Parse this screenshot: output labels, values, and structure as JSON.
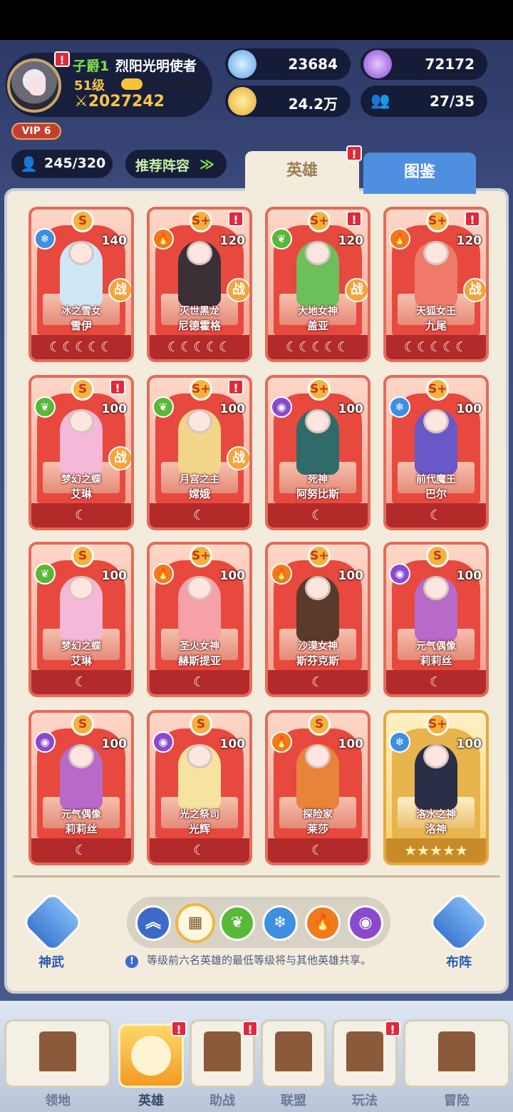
{
  "player": {
    "rank": "子爵1",
    "honor_title": "烈阳光明使者",
    "level": "51级",
    "xp_progress": 0.25,
    "power": "2027242",
    "vip": "VIP 6"
  },
  "resources": [
    {
      "icon": "star-crystal-icon",
      "value": "23684"
    },
    {
      "icon": "purple-gem-icon",
      "value": "72172"
    },
    {
      "icon": "gold-coin-icon",
      "value": "24.2万"
    },
    {
      "icon": "friends-icon",
      "value": "27/35"
    }
  ],
  "hero_count": "245/320",
  "recommend_label": "推荐阵容",
  "tabs": {
    "heroes": "英雄",
    "album": "图鉴"
  },
  "heroes": [
    {
      "grade": "S",
      "element": "ice",
      "level": "140",
      "title": "冰之雪女",
      "name": "雪伊",
      "fight": true,
      "moons": 5,
      "alert": false,
      "color": "#cfe6f6"
    },
    {
      "grade": "S+",
      "element": "fire",
      "level": "120",
      "title": "灭世黑龙",
      "name": "尼德霍格",
      "fight": true,
      "moons": 5,
      "alert": true,
      "color": "#3a3036"
    },
    {
      "grade": "S+",
      "element": "wind",
      "level": "120",
      "title": "大地女神",
      "name": "盖亚",
      "fight": true,
      "moons": 5,
      "alert": true,
      "color": "#6cbf5a"
    },
    {
      "grade": "S+",
      "element": "fire",
      "level": "120",
      "title": "天狐女王",
      "name": "九尾",
      "fight": true,
      "moons": 5,
      "alert": true,
      "color": "#f07a6a"
    },
    {
      "grade": "S",
      "element": "wind",
      "level": "100",
      "title": "梦幻之蝶",
      "name": "艾琳",
      "fight": true,
      "moons": 1,
      "alert": true,
      "color": "#f5b8d8"
    },
    {
      "grade": "S+",
      "element": "wind",
      "level": "100",
      "title": "月宫之主",
      "name": "嫦娥",
      "fight": true,
      "moons": 1,
      "alert": true,
      "color": "#f3d58a"
    },
    {
      "grade": "S+",
      "element": "dark",
      "level": "100",
      "title": "死神",
      "name": "阿努比斯",
      "fight": false,
      "moons": 1,
      "alert": false,
      "color": "#2f6b6a"
    },
    {
      "grade": "S+",
      "element": "ice",
      "level": "100",
      "title": "前代魔王",
      "name": "巴尔",
      "fight": false,
      "moons": 1,
      "alert": false,
      "color": "#6a58c8"
    },
    {
      "grade": "S",
      "element": "wind",
      "level": "100",
      "title": "梦幻之蝶",
      "name": "艾琳",
      "fight": false,
      "moons": 1,
      "alert": false,
      "color": "#f5b8d8"
    },
    {
      "grade": "S+",
      "element": "fire",
      "level": "100",
      "title": "圣火女神",
      "name": "赫斯提亚",
      "fight": false,
      "moons": 1,
      "alert": false,
      "color": "#f6a0a8"
    },
    {
      "grade": "S+",
      "element": "fire",
      "level": "100",
      "title": "沙漠女神",
      "name": "斯芬克斯",
      "fight": false,
      "moons": 1,
      "alert": false,
      "color": "#5a3a2a"
    },
    {
      "grade": "S",
      "element": "dark",
      "level": "100",
      "title": "元气偶像",
      "name": "莉莉丝",
      "fight": false,
      "moons": 1,
      "alert": false,
      "color": "#b86ac8"
    },
    {
      "grade": "S",
      "element": "dark",
      "level": "100",
      "title": "元气偶像",
      "name": "莉莉丝",
      "fight": false,
      "moons": 1,
      "alert": false,
      "color": "#b86ac8"
    },
    {
      "grade": "S",
      "element": "dark",
      "level": "100",
      "title": "光之祭司",
      "name": "光辉",
      "fight": false,
      "moons": 1,
      "alert": false,
      "color": "#f6e3a0"
    },
    {
      "grade": "S",
      "element": "fire",
      "level": "100",
      "title": "探险家",
      "name": "莱莎",
      "fight": false,
      "moons": 1,
      "alert": false,
      "color": "#e8833a"
    },
    {
      "grade": "S+",
      "element": "ice",
      "level": "100",
      "title": "洛水之神",
      "name": "洛神",
      "fight": false,
      "stars": 5,
      "alert": false,
      "gold": true,
      "color": "#2a2f48"
    }
  ],
  "fight_label": "战",
  "element_colors": {
    "ice": "#3d8fe0",
    "fire": "#f07a1c",
    "wind": "#58b838",
    "dark": "#8a4ad0"
  },
  "element_glyphs": {
    "ice": "❄",
    "fire": "🔥",
    "wind": "❦",
    "dark": "◉"
  },
  "filters": [
    {
      "icon": "collapse-up-icon",
      "glyph": "︽",
      "color": "#3d6ac8"
    },
    {
      "icon": "grid-all-icon",
      "glyph": "▦",
      "color": "#fff7e0",
      "selected": true
    },
    {
      "icon": "wind-element-icon",
      "glyph": "❦",
      "color": "#58b838"
    },
    {
      "icon": "ice-element-icon",
      "glyph": "❄",
      "color": "#3d8fe0"
    },
    {
      "icon": "fire-element-icon",
      "glyph": "🔥",
      "color": "#f07a1c"
    },
    {
      "icon": "dark-element-icon",
      "glyph": "◉",
      "color": "#8a4ad0"
    }
  ],
  "side_left_label": "神武",
  "side_right_label": "布阵",
  "notice": "等级前六名英雄的最低等级将与其他英雄共享。",
  "nav": [
    {
      "label": "领地",
      "alert": false
    },
    {
      "label": "英雄",
      "alert": true,
      "active": true
    },
    {
      "label": "助战",
      "alert": true
    },
    {
      "label": "联盟",
      "alert": false
    },
    {
      "label": "玩法",
      "alert": true
    },
    {
      "label": "冒险",
      "alert": false
    }
  ]
}
